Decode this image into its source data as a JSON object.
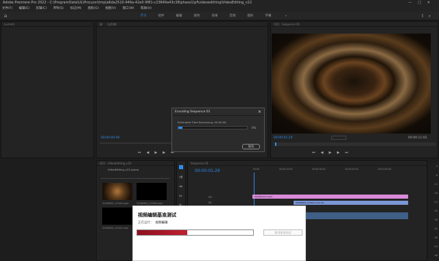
{
  "title": "Adobe Premiere Pro 2022 - C:\\ProgramData\\UL\\Procyon\\tmp\\a6da2510-946a-42e0-9f81-c23849a43c38\\phase1\\pFuideoeditting\\VideoEditing_v22",
  "window_controls": [
    "—",
    "□",
    "✕"
  ],
  "menu": [
    "文件(F)",
    "编辑(E)",
    "剪辑(C)",
    "序列(S)",
    "标记(M)",
    "图形(G)",
    "视图(V)",
    "窗口(W)",
    "帮助(H)"
  ],
  "workspace_tabs": [
    {
      "label": "学习",
      "active": true
    },
    {
      "label": "组件",
      "active": false
    },
    {
      "label": "编辑",
      "active": false
    },
    {
      "label": "颜色",
      "active": false
    },
    {
      "label": "效果",
      "active": false
    },
    {
      "label": "音频",
      "active": false
    },
    {
      "label": "图形",
      "active": false
    },
    {
      "label": "字幕",
      "active": false
    },
    {
      "label": "»",
      "active": false
    }
  ],
  "panels": {
    "left_header": "Lumetri",
    "source_header": "源：（无剪辑）",
    "program_header": "节目：Sequence 01",
    "project_header": "项目：VideoEditing_v22",
    "project_file": "VideoEditing_v22.prproj",
    "timeline_header": "Sequence 01",
    "source_tc": "00:00:00:00",
    "program_tc_left": "00:00:01:29",
    "program_tc_right": "00:00:11:02",
    "timeline_tc": "00:00:01:29"
  },
  "project_items": [
    {
      "name": "20180609_12345a.mp4",
      "dur": "14:29"
    },
    {
      "name": "20180609_12345b.mp4",
      "dur": "1:14:29"
    },
    {
      "name": "20180609_12345c.mp4",
      "dur": "13:00"
    },
    {
      "name": "20180609_12345d.mp4",
      "dur": "2:14:29"
    }
  ],
  "timeline": {
    "ruler": [
      "00:00",
      "00:00:15:00",
      "00:00:30:00",
      "00:00:45:00",
      "00:01:00:00"
    ],
    "tracks": [
      {
        "label": "Adjustment Layer",
        "color": "#d98ad9"
      },
      {
        "label": "20180609_12345a.mp4 [V]",
        "color": "#7a96d6"
      }
    ],
    "track_names": [
      "V3",
      "V2",
      "V1",
      "A1"
    ]
  },
  "encoding_dialog": {
    "title": "Encoding Sequence 01",
    "estimate": "Estimated Time Remaining: 00:00:06",
    "percent": "0%",
    "progress": 0.06,
    "cancel": "取消"
  },
  "benchmark": {
    "title": "视频编辑基准测试",
    "status_label": "正在运行：",
    "status_value": "视频编辑",
    "progress": 0.43,
    "button": "取消基准测试"
  },
  "meter_ticks": [
    "0",
    "-6",
    "-12",
    "-18",
    "-24",
    "-30",
    "-36",
    "-42",
    "-48",
    "-54",
    "dB"
  ],
  "colors": {
    "accent": "#2d8ceb",
    "bench": "#b01c2e"
  }
}
